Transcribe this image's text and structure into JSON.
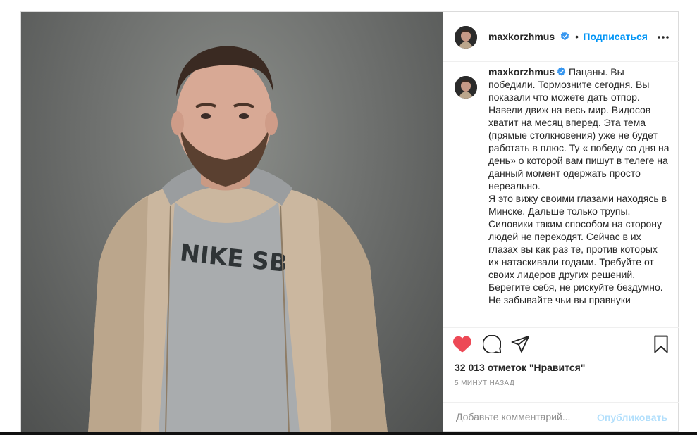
{
  "post": {
    "username": "maxkorzhmus",
    "follow_label": "Подписаться",
    "bullet": "•",
    "caption": "Пацаны. Вы победили. Тормозните сегодня. Вы показали что можете дать отпор. Навели движ на весь мир. Видосов хватит на месяц вперед. Эта тема (прямые столкновения) уже не будет работать в плюс. Ту « победу со дня на день» о которой вам пишут в телеге на данный момент одержать просто нереально.\nЯ это вижу своими глазами находясь в Минске. Дальше только трупы. Силовики таким способом на сторону людей не переходят. Сейчас в их глазах вы как раз те, против которых их натаскивали годами. Требуйте от своих лидеров других решений.\nБерегите себя, не рискуйте бездумно.\nНе забывайте чьи вы правнуки",
    "likes": "32 013 отметок \"Нравится\"",
    "time_ago": "5 МИНУТ НАЗАД",
    "comment_placeholder": "Добавьте комментарий...",
    "publish_label": "Опубликовать",
    "liked": true
  },
  "icons": {
    "like": "heart-icon",
    "comment": "comment-icon",
    "share": "share-icon",
    "save": "bookmark-icon",
    "more": "more-icon",
    "verified": "verified-badge-icon"
  },
  "colors": {
    "accent": "#0095f6",
    "like": "#ed4956",
    "publish_disabled": "#b2dffc",
    "muted": "#8e8e8e",
    "border": "#dbdbdb"
  }
}
